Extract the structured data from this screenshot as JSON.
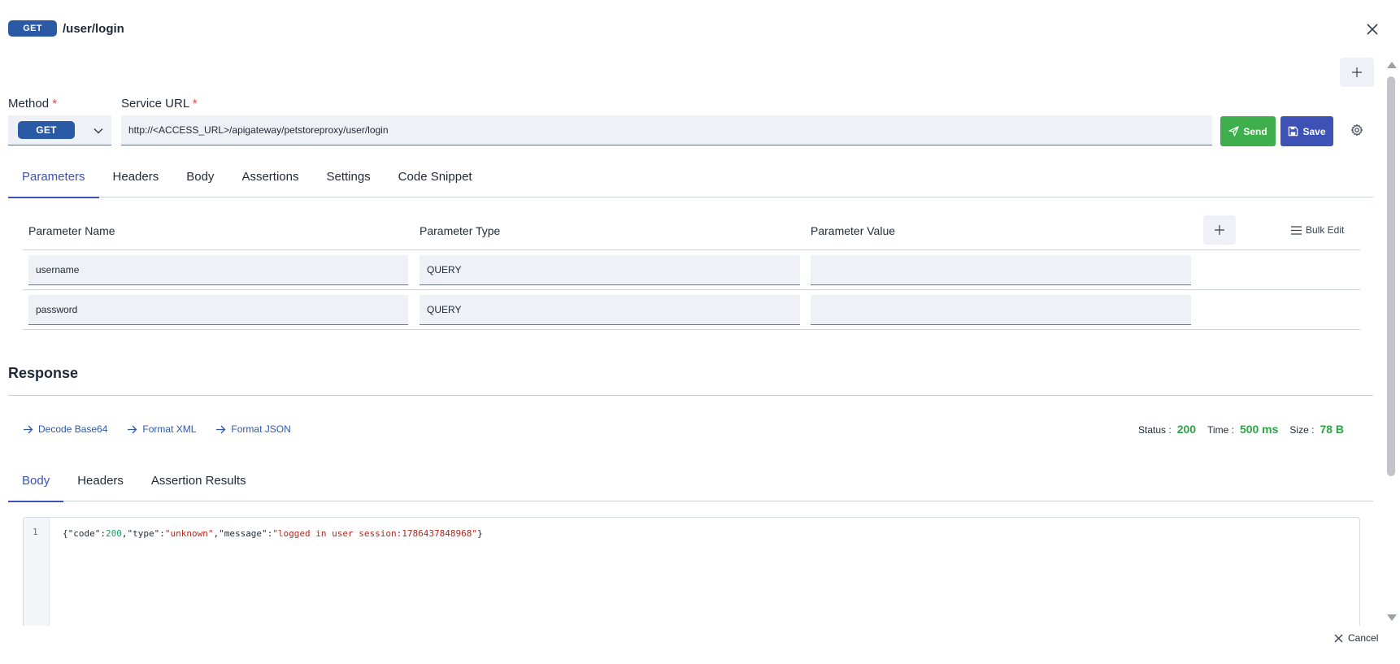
{
  "header": {
    "method": "GET",
    "path": "/user/login"
  },
  "form": {
    "method_label": "Method",
    "url_label": "Service URL",
    "required_mark": "*",
    "method_value": "GET",
    "url_value": "http://<ACCESS_URL>/apigateway/petstoreproxy/user/login",
    "send_label": "Send",
    "save_label": "Save"
  },
  "tabs": [
    {
      "label": "Parameters",
      "active": true
    },
    {
      "label": "Headers",
      "active": false
    },
    {
      "label": "Body",
      "active": false
    },
    {
      "label": "Assertions",
      "active": false
    },
    {
      "label": "Settings",
      "active": false
    },
    {
      "label": "Code Snippet",
      "active": false
    }
  ],
  "params": {
    "columns": [
      "Parameter Name",
      "Parameter Type",
      "Parameter Value"
    ],
    "bulk_edit_label": "Bulk Edit",
    "rows": [
      {
        "name": "username",
        "type": "QUERY",
        "value": ""
      },
      {
        "name": "password",
        "type": "QUERY",
        "value": ""
      }
    ]
  },
  "response": {
    "title": "Response",
    "actions": [
      "Decode Base64",
      "Format XML",
      "Format JSON"
    ],
    "status_label": "Status :",
    "status_value": "200",
    "time_label": "Time :",
    "time_value": "500 ms",
    "size_label": "Size :",
    "size_value": "78 B",
    "tabs": [
      {
        "label": "Body",
        "active": true
      },
      {
        "label": "Headers",
        "active": false
      },
      {
        "label": "Assertion Results",
        "active": false
      }
    ],
    "line_number": "1",
    "body": {
      "p1": "{\"code\":",
      "code": "200",
      "p2": ",\"type\":",
      "type": "\"unknown\"",
      "p3": ",\"message\":",
      "message": "\"logged in user session:1786437848968\"",
      "p4": "}"
    }
  },
  "footer": {
    "cancel_label": "Cancel"
  },
  "colors": {
    "accent": "#3d52b4",
    "send": "#3fae4c",
    "status_ok": "#2fa245",
    "method_badge": "#2a5aa5"
  }
}
